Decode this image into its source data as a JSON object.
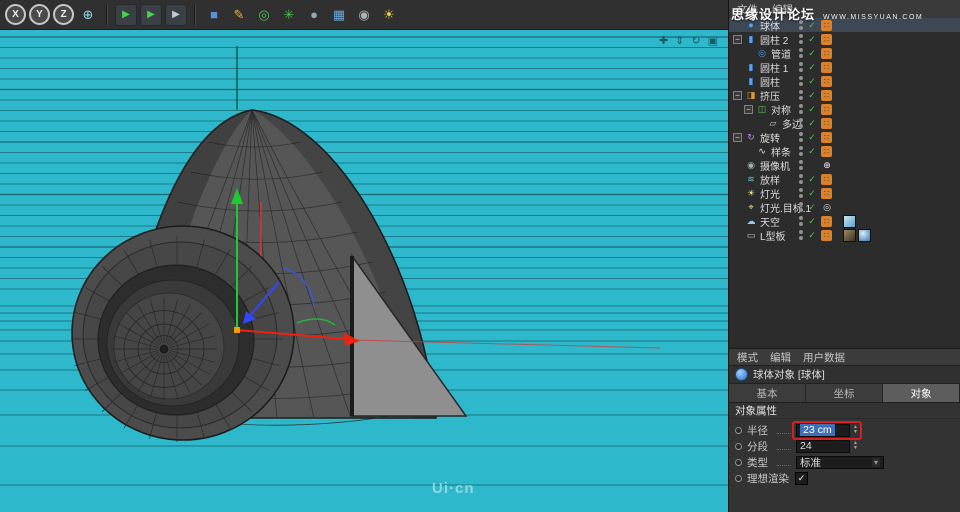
{
  "toolbar": {
    "items": [
      {
        "name": "lock-x-axis-button",
        "glyph": "X",
        "style": "circle"
      },
      {
        "name": "lock-y-axis-button",
        "glyph": "Y",
        "style": "circle"
      },
      {
        "name": "lock-z-axis-button",
        "glyph": "Z",
        "style": "circle"
      },
      {
        "name": "coordinate-system-button",
        "glyph": "⊕",
        "style": "plain",
        "color": "#8fd4ea"
      },
      {
        "type": "sep"
      },
      {
        "name": "render-view-button",
        "glyph": "▶",
        "style": "boxed",
        "color": "#49d44e"
      },
      {
        "name": "render-picture-viewer-button",
        "glyph": "▶",
        "style": "boxed",
        "color": "#49d44e"
      },
      {
        "name": "render-settings-button",
        "glyph": "▶",
        "style": "boxed",
        "color": "#c3cacf"
      },
      {
        "type": "sep"
      },
      {
        "name": "primitive-cube-button",
        "glyph": "■",
        "style": "plain",
        "color": "#5b8dd9"
      },
      {
        "name": "spline-pen-button",
        "glyph": "✎",
        "style": "plain",
        "color": "#e8b34b"
      },
      {
        "name": "mograph-button",
        "glyph": "◎",
        "style": "plain",
        "color": "#49c24f"
      },
      {
        "name": "effector-button",
        "glyph": "✳",
        "style": "plain",
        "color": "#49c24f"
      },
      {
        "name": "simulation-button",
        "glyph": "●",
        "style": "plain",
        "color": "#93a7bb"
      },
      {
        "name": "array-button",
        "glyph": "▦",
        "style": "plain",
        "color": "#6aa7d8"
      },
      {
        "name": "camera-button",
        "glyph": "◉",
        "style": "plain",
        "color": "#aab4b8"
      },
      {
        "name": "light-button",
        "glyph": "☀",
        "style": "plain",
        "color": "#e8d44d"
      }
    ]
  },
  "viewport": {
    "nav": [
      {
        "name": "pan-view-button",
        "glyph": "✚"
      },
      {
        "name": "zoom-view-button",
        "glyph": "⇕"
      },
      {
        "name": "rotate-view-button",
        "glyph": "↻"
      },
      {
        "name": "maximize-view-button",
        "glyph": "▣"
      }
    ]
  },
  "watermarks": {
    "site_title": "思缘设计论坛",
    "site_url": "WWW.MISSYUAN.COM",
    "viewport_logo": "Ui·cn"
  },
  "object_manager": {
    "menu": [
      "文件",
      "编辑"
    ],
    "rows": [
      {
        "label": "球体",
        "icon": "sphere-icon",
        "glyph": "●",
        "color": "#4da3ff",
        "indent": 0,
        "selected": true,
        "check": true,
        "tag": "orange"
      },
      {
        "label": "圆柱 2",
        "icon": "cylinder-icon",
        "glyph": "▮",
        "color": "#4da3ff",
        "indent": 0,
        "expand": true,
        "check": true,
        "tag": "orange"
      },
      {
        "label": "管道",
        "icon": "tube-icon",
        "glyph": "◎",
        "color": "#4da3ff",
        "indent": 1,
        "check": true,
        "tag": "orange"
      },
      {
        "label": "圆柱 1",
        "icon": "cylinder-icon",
        "glyph": "▮",
        "color": "#4da3ff",
        "indent": 0,
        "check": true,
        "tag": "orange"
      },
      {
        "label": "圆柱",
        "icon": "cylinder-icon",
        "glyph": "▮",
        "color": "#4da3ff",
        "indent": 0,
        "check": true,
        "tag": "orange"
      },
      {
        "label": "挤压",
        "icon": "extrude-icon",
        "glyph": "◨",
        "color": "#e09a3c",
        "indent": 0,
        "expand": true,
        "check": true,
        "tag": "orange"
      },
      {
        "label": "对称",
        "icon": "symmetry-icon",
        "glyph": "◫",
        "color": "#57c25a",
        "indent": 1,
        "expand": true,
        "check": true,
        "tag": "orange"
      },
      {
        "label": "多边",
        "icon": "polygon-icon",
        "glyph": "▱",
        "color": "#cfcfcf",
        "indent": 2,
        "check": true,
        "tag": "orange"
      },
      {
        "label": "旋转",
        "icon": "lathe-icon",
        "glyph": "↻",
        "color": "#c08be0",
        "indent": 0,
        "expand": true,
        "check": true,
        "tag": "orange"
      },
      {
        "label": "样条",
        "icon": "spline-icon",
        "glyph": "∿",
        "color": "#e6e6e6",
        "indent": 1,
        "check": true,
        "tag": "orange"
      },
      {
        "label": "摄像机",
        "icon": "camera-icon",
        "glyph": "◉",
        "color": "#9fb3a9",
        "indent": 0,
        "check": false,
        "tag": "target"
      },
      {
        "label": "放样",
        "icon": "loft-icon",
        "glyph": "≋",
        "color": "#5bc0d8",
        "indent": 0,
        "check": true,
        "tag": "orange"
      },
      {
        "label": "灯光",
        "icon": "light-icon",
        "glyph": "☀",
        "color": "#f0e68c",
        "indent": 0,
        "check": true,
        "tag": "orange"
      },
      {
        "label": "灯光.目标.1",
        "icon": "light-target-icon",
        "glyph": "⌖",
        "color": "#f0e68c",
        "indent": 0,
        "check": true,
        "tag": "circle"
      },
      {
        "label": "天空",
        "icon": "sky-icon",
        "glyph": "☁",
        "color": "#8fd0f0",
        "indent": 0,
        "check": true,
        "tag": "orange",
        "thumbs": [
          "sky"
        ]
      },
      {
        "label": "L型板",
        "icon": "board-icon",
        "glyph": "▭",
        "color": "#c8c8c8",
        "indent": 0,
        "check": true,
        "tag": "orange",
        "thumbs": [
          "dark",
          "ball"
        ]
      }
    ]
  },
  "attribute_manager": {
    "menu": [
      "模式",
      "编辑",
      "用户数据"
    ],
    "title": "球体对象 [球体]",
    "tabs": [
      {
        "key": "basic",
        "label": "基本",
        "active": false
      },
      {
        "key": "coord",
        "label": "坐标",
        "active": false
      },
      {
        "key": "object",
        "label": "对象",
        "active": true
      }
    ],
    "section": "对象属性",
    "rows": [
      {
        "key": "radius",
        "label": "半径",
        "type": "number",
        "value": "23 cm",
        "selected": true,
        "highlight": true
      },
      {
        "key": "segments",
        "label": "分段",
        "type": "number",
        "value": "24"
      },
      {
        "key": "type",
        "label": "类型",
        "type": "dropdown",
        "value": "标准"
      },
      {
        "key": "render-perfect",
        "label": "理想渲染",
        "type": "checkbox",
        "checked": true
      }
    ]
  },
  "colors": {
    "viewport_bg": "#2db9cb",
    "grid_line": "#0a323c",
    "selection_blue": "#3f6fb5",
    "highlight_red": "#d42222",
    "check_green": "#4fc454",
    "tag_orange": "#d9822b"
  }
}
